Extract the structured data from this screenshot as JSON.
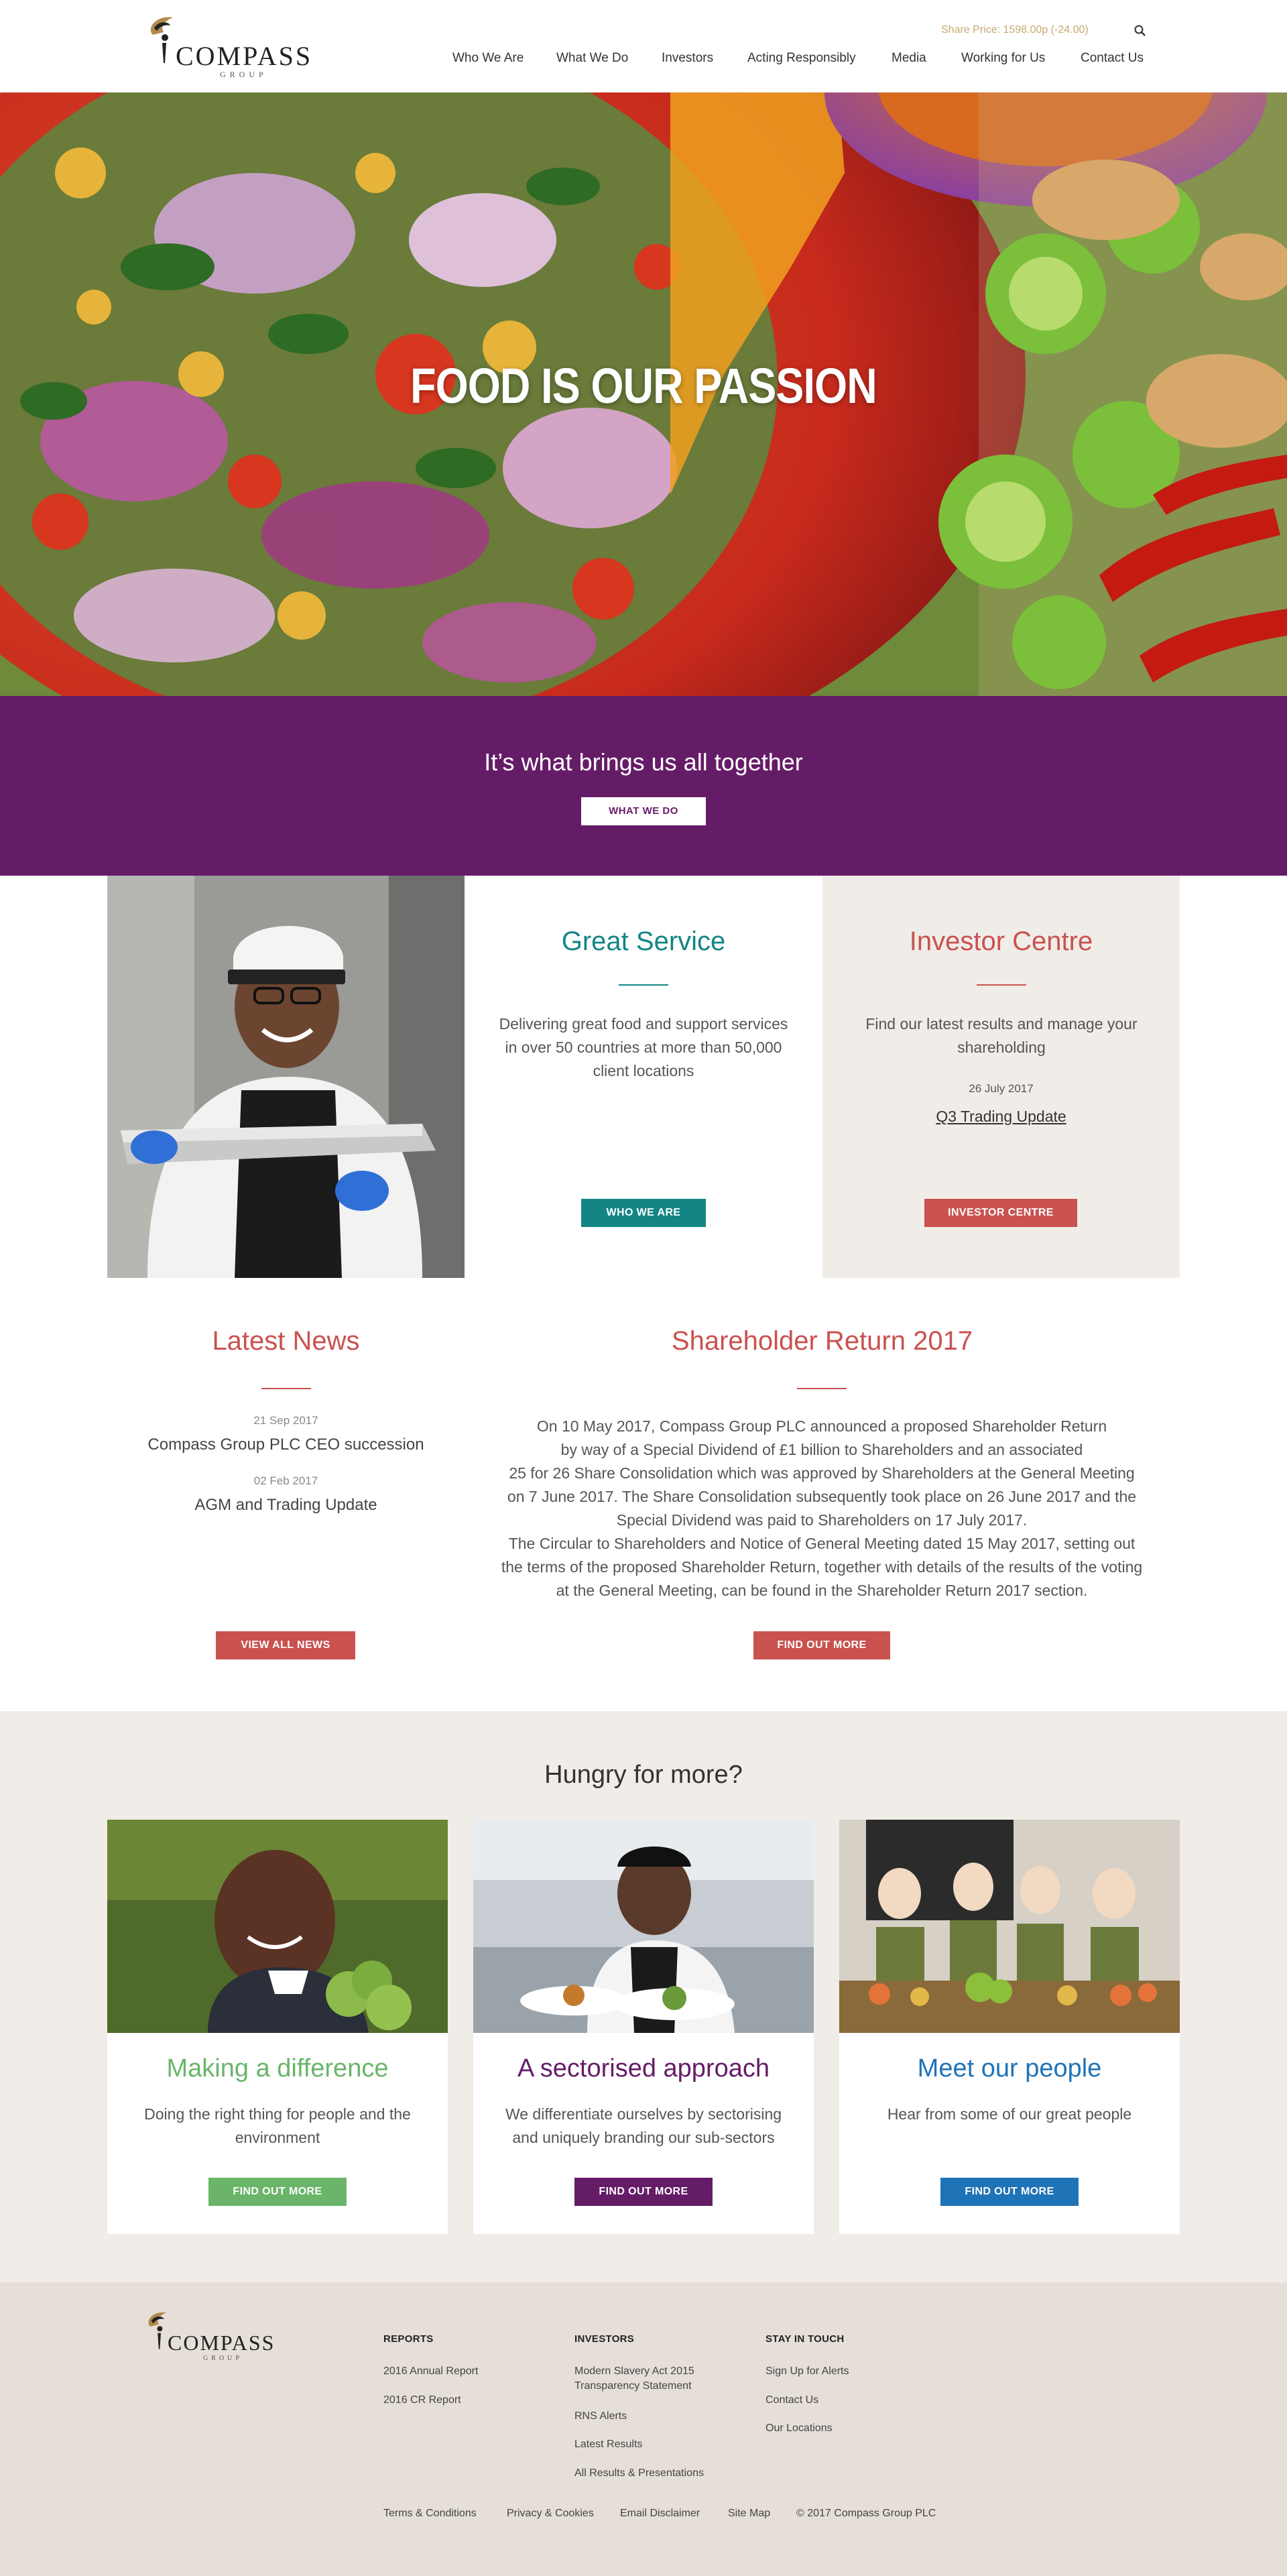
{
  "header": {
    "logo_text": "COMPASS",
    "logo_sub": "GROUP",
    "share_price": "Share Price: 1598.00p (-24.00)",
    "search_icon": "search-icon",
    "nav": [
      "Who We Are",
      "What We Do",
      "Investors",
      "Acting Responsibly",
      "Media",
      "Working for Us",
      "Contact Us"
    ]
  },
  "hero": {
    "title": "FOOD IS OUR PASSION"
  },
  "band": {
    "text": "It’s what brings us all together",
    "button": "WHAT WE DO"
  },
  "service": {
    "title": "Great Service",
    "body": "Delivering great food and support services in over 50 countries at more than 50,000 client locations",
    "button": "WHO WE ARE",
    "color": "#138585"
  },
  "investor": {
    "title": "Investor Centre",
    "body": "Find our latest results and manage your shareholding",
    "date": "26 July 2017",
    "link": "Q3 Trading Update",
    "button": "INVESTOR CENTRE",
    "color": "#c9524f"
  },
  "news": {
    "title": "Latest News",
    "items": [
      {
        "date": "21 Sep 2017",
        "headline": "Compass Group PLC CEO succession"
      },
      {
        "date": "02 Feb 2017",
        "headline": "AGM and Trading Update"
      }
    ],
    "button": "VIEW ALL NEWS"
  },
  "shareholder": {
    "title": "Shareholder Return 2017",
    "lines": [
      "On 10 May 2017, Compass Group PLC announced a proposed Shareholder Return",
      "by way of a Special Dividend of £1 billion to Shareholders and an associated",
      "25 for 26 Share Consolidation which was approved by Shareholders at the General Meeting",
      "on 7 June 2017. The Share Consolidation subsequently took place on 26 June 2017 and the",
      "Special Dividend was paid to Shareholders on 17 July 2017.",
      "The Circular to Shareholders and Notice of General Meeting dated 15 May 2017, setting out",
      "the terms of the proposed Shareholder Return, together with details of the results of the voting",
      "at the General Meeting, can be found in the Shareholder Return 2017 section."
    ],
    "button": "FIND OUT MORE"
  },
  "hungry": {
    "title": "Hungry for more?",
    "cards": [
      {
        "title": "Making a difference",
        "body": "Doing the right thing for people and the environment",
        "button": "FIND OUT MORE",
        "color": "#6ab56a"
      },
      {
        "title": "A sectorised approach",
        "body": "We differentiate ourselves by sectorising and uniquely branding our sub-sectors",
        "button": "FIND OUT MORE",
        "color": "#651c67"
      },
      {
        "title": "Meet our people",
        "body": "Hear from some of our great people",
        "button": "FIND OUT MORE",
        "color": "#1f73b7"
      }
    ]
  },
  "footer": {
    "logo_text": "COMPASS",
    "logo_sub": "GROUP",
    "reports": {
      "title": "REPORTS",
      "links": [
        "2016 Annual Report",
        "2016 CR Report"
      ]
    },
    "investors": {
      "title": "INVESTORS",
      "links": [
        "Modern Slavery Act 2015 Transparency Statement",
        "RNS Alerts",
        "Latest Results",
        "All Results & Presentations"
      ]
    },
    "stay": {
      "title": "STAY IN TOUCH",
      "links": [
        "Sign Up for Alerts",
        "Contact Us",
        "Our Locations"
      ]
    },
    "bottom": [
      "Terms & Conditions",
      "Privacy & Cookies",
      "Email Disclaimer",
      "Site Map",
      "© 2017 Compass Group PLC"
    ]
  }
}
